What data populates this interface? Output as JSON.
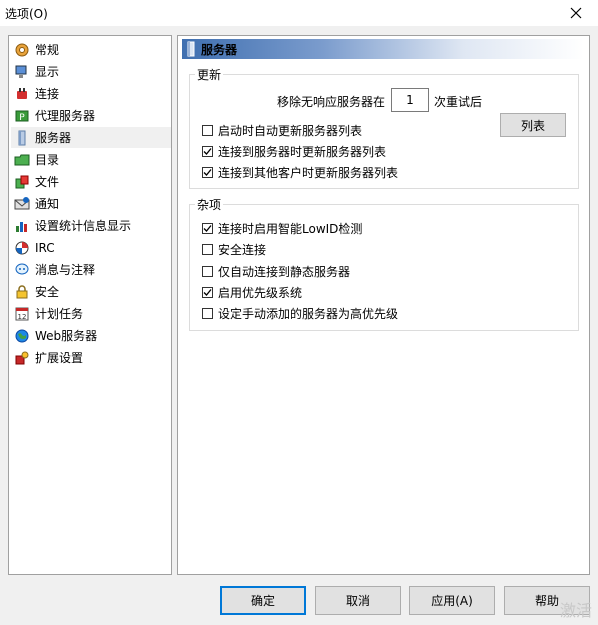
{
  "window": {
    "title": "选项(O)"
  },
  "nav": [
    {
      "label": "常规",
      "icon": "gear-icon"
    },
    {
      "label": "显示",
      "icon": "monitor-icon"
    },
    {
      "label": "连接",
      "icon": "plug-icon"
    },
    {
      "label": "代理服务器",
      "icon": "proxy-icon"
    },
    {
      "label": "服务器",
      "icon": "server-icon",
      "selected": true
    },
    {
      "label": "目录",
      "icon": "folder-icon"
    },
    {
      "label": "文件",
      "icon": "files-icon"
    },
    {
      "label": "通知",
      "icon": "notification-icon"
    },
    {
      "label": "设置统计信息显示",
      "icon": "statistics-icon"
    },
    {
      "label": "IRC",
      "icon": "irc-icon"
    },
    {
      "label": "消息与注释",
      "icon": "message-icon"
    },
    {
      "label": "安全",
      "icon": "lock-icon"
    },
    {
      "label": "计划任务",
      "icon": "calendar-icon"
    },
    {
      "label": "Web服务器",
      "icon": "globe-icon"
    },
    {
      "label": "扩展设置",
      "icon": "extension-icon"
    }
  ],
  "panel": {
    "title": "服务器",
    "update": {
      "label": "更新",
      "remove_prefix": "移除无响应服务器在",
      "retries": "1",
      "remove_suffix": "次重试后",
      "list_button": "列表",
      "options": [
        {
          "label": "启动时自动更新服务器列表",
          "checked": false
        },
        {
          "label": "连接到服务器时更新服务器列表",
          "checked": true
        },
        {
          "label": "连接到其他客户时更新服务器列表",
          "checked": true
        }
      ]
    },
    "misc": {
      "label": "杂项",
      "options": [
        {
          "label": "连接时启用智能LowID检测",
          "checked": true
        },
        {
          "label": "安全连接",
          "checked": false
        },
        {
          "label": "仅自动连接到静态服务器",
          "checked": false
        },
        {
          "label": "启用优先级系统",
          "checked": true
        },
        {
          "label": "设定手动添加的服务器为高优先级",
          "checked": false
        }
      ]
    }
  },
  "buttons": {
    "ok": "确定",
    "cancel": "取消",
    "apply": "应用(A)",
    "help": "帮助"
  },
  "watermark": "激活",
  "colors": {
    "accent": "#0078d7",
    "header_start": "#3f6fb0"
  }
}
